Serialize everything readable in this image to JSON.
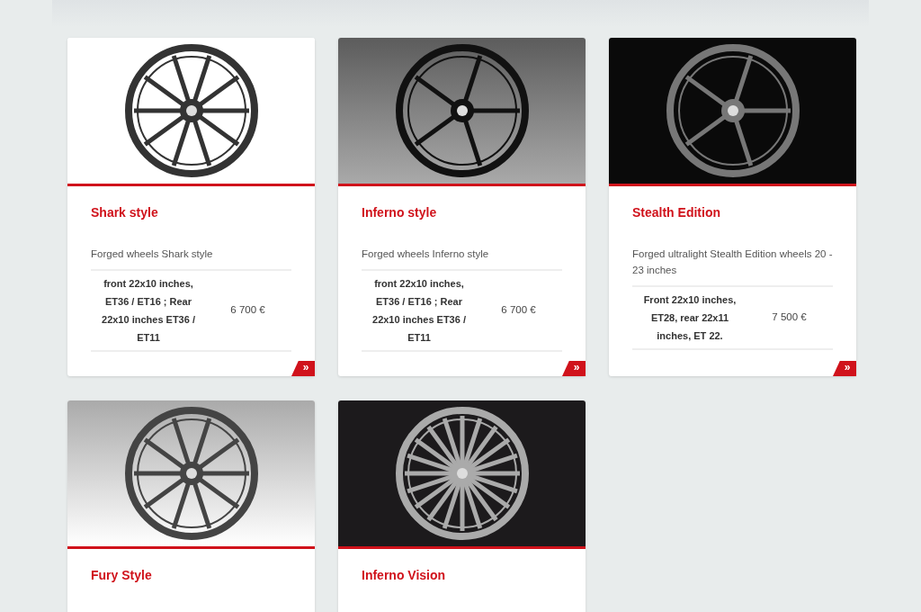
{
  "products": [
    {
      "title": "Shark style",
      "description": "Forged wheels Shark style",
      "specs": "front 22x10 inches, ET36 / ET16 ; Rear 22x10 inches ET36 / ET11",
      "price": "6 700 €",
      "more": "»"
    },
    {
      "title": "Inferno style",
      "description": "Forged wheels Inferno style",
      "specs": "front 22x10 inches, ET36 / ET16 ; Rear 22x10 inches ET36 / ET11",
      "price": "6 700 €",
      "more": "»"
    },
    {
      "title": "Stealth Edition",
      "description": "Forged ultralight Stealth Edition wheels 20 - 23 inches",
      "specs": "Front 22x10 inches, ET28, rear 22x11 inches, ET 22.",
      "price": "7 500 €",
      "more": "»"
    },
    {
      "title": "Fury Style"
    },
    {
      "title": "Inferno Vision"
    }
  ]
}
